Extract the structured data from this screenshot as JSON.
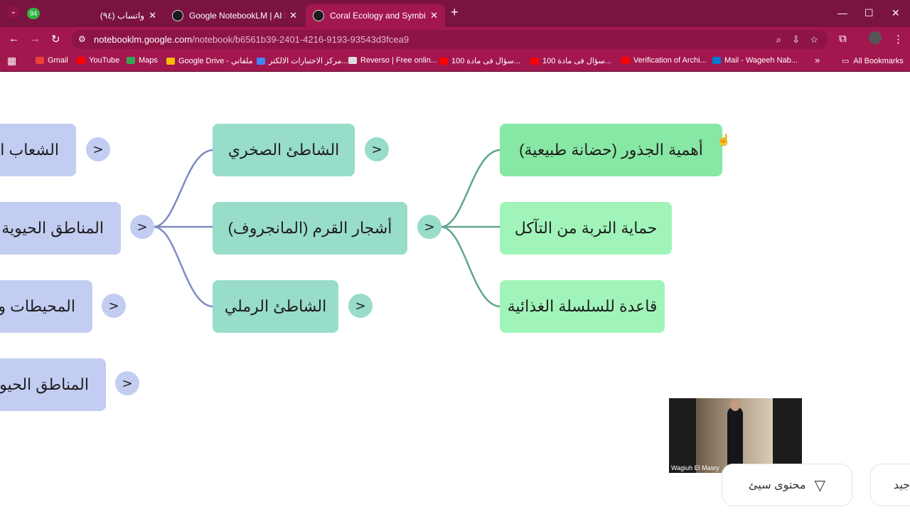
{
  "browser": {
    "tab_count_badge": "94",
    "tabs": [
      {
        "title": "(٩٤) واتساب",
        "close": "✕"
      },
      {
        "title": "Google NotebookLM | AI Research",
        "close": "✕"
      },
      {
        "title": "Coral Ecology and Symbiosis Ac",
        "close": "✕"
      }
    ],
    "new_tab": "+",
    "url_host": "notebooklm.google.com",
    "url_path": "/notebook/b6561b39-2401-4216-9193-93543d3fcea9",
    "bookmarks": [
      {
        "label": "Gmail",
        "color": "#ea4335"
      },
      {
        "label": "YouTube",
        "color": "#ff0000"
      },
      {
        "label": "Maps",
        "color": "#34a853"
      },
      {
        "label": "Google Drive - ملفاتي",
        "color": "#fbbc04"
      },
      {
        "label": "مركز الاختبارات الالكتر...",
        "color": "#4285f4"
      },
      {
        "label": "Reverso | Free onlin...",
        "color": "#dddddd"
      },
      {
        "label": "100 سؤال فى مادة...",
        "color": "#ff0000"
      },
      {
        "label": "100 سؤال فى مادة...",
        "color": "#ff0000"
      },
      {
        "label": "Verification of Archi...",
        "color": "#ff0000"
      },
      {
        "label": "Mail - Wageeh Nab...",
        "color": "#0078d4"
      }
    ],
    "more_bookmarks": "»",
    "all_bookmarks": "All Bookmarks"
  },
  "mindmap": {
    "left_column": [
      {
        "label": "الشعاب المرجانية"
      },
      {
        "label": "المناطق الحيوية"
      },
      {
        "label": "المحيطات والبحار"
      },
      {
        "label": "المناطق الحيوية"
      }
    ],
    "middle_column": [
      {
        "label": "الشاطئ الصخري"
      },
      {
        "label": "أشجار القرم (المانجروف)"
      },
      {
        "label": "الشاطئ الرملي"
      }
    ],
    "right_column": [
      {
        "label": "أهمية الجذور (حضانة طبيعية)"
      },
      {
        "label": "حماية التربة من التآكل"
      },
      {
        "label": "قاعدة للسلسلة الغذائية"
      }
    ],
    "toggle_symbol": ">"
  },
  "video_overlay": {
    "name": "Wagiuh El Masry"
  },
  "feedback": {
    "bad_label": "محتوى سيئ",
    "good_label": "محتوى جيد"
  },
  "colors": {
    "blue_node": "#c3cdf2",
    "teal_node": "#97ddc9",
    "green_node": "#a0f4b9",
    "blue_link": "#7f8ac4",
    "teal_link": "#5fa58f"
  }
}
